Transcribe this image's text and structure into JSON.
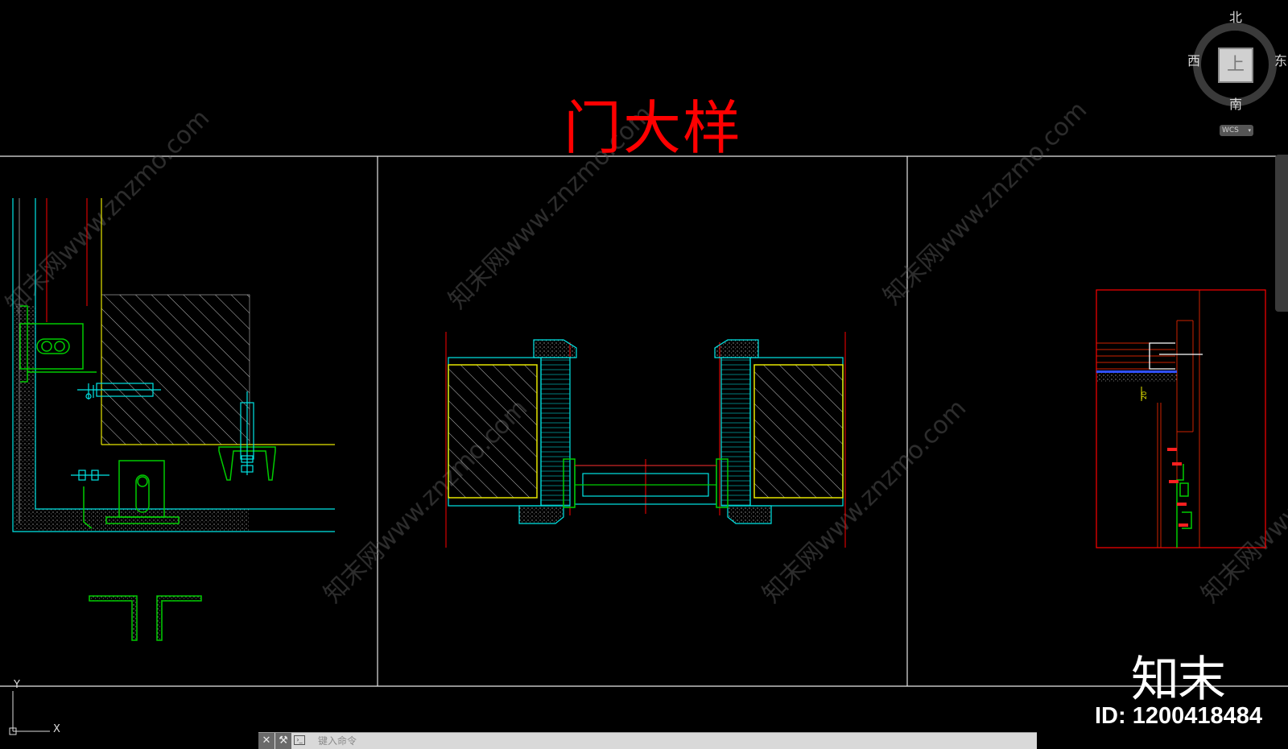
{
  "drawing": {
    "title": "门大样",
    "dimension_label": "20"
  },
  "viewcube": {
    "face": "上",
    "north": "北",
    "south": "南",
    "east": "东",
    "west": "西",
    "coordinate_system": "WCS",
    "coordinate_dropdown_icon": "chevron-down-icon"
  },
  "ucs": {
    "x_axis": "X",
    "y_axis": "Y"
  },
  "watermark": {
    "text": "知末网www.znzmo.com",
    "brand": "知末",
    "image_id": "ID: 1200418484"
  },
  "command_line": {
    "close_icon": "close-icon",
    "customize_icon": "wrench-icon",
    "prompt_icon": "command-prompt-icon",
    "placeholder": "键入命令"
  },
  "colors": {
    "background": "#000000",
    "title": "#ff0000",
    "frame_lines": "#ffffff",
    "cyan_lines": "#00ffff",
    "yellow_lines": "#ffff00",
    "green_lines": "#00cc00",
    "red_lines": "#ff0000"
  }
}
